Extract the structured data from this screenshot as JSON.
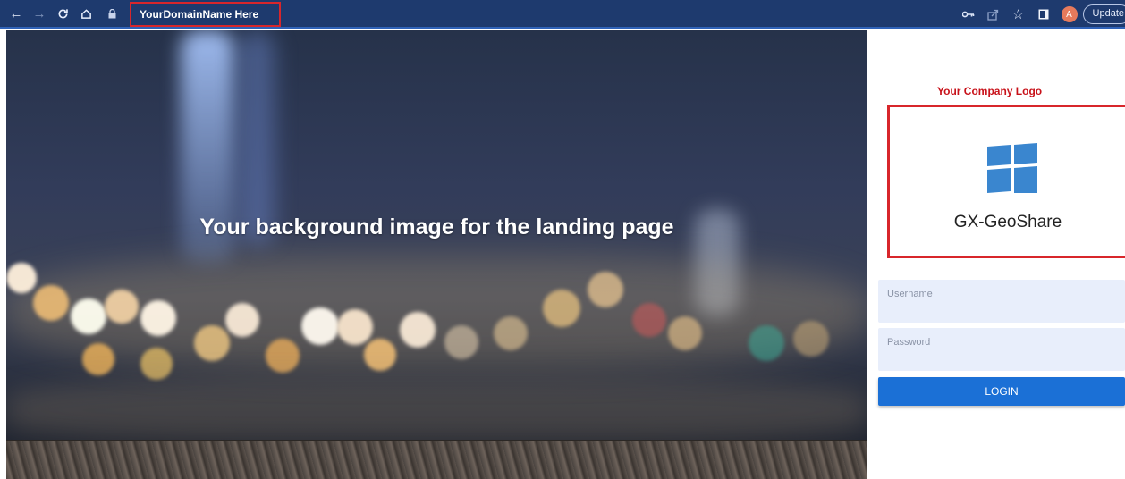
{
  "browser": {
    "url": "YourDomainName Here",
    "update_label": "Update",
    "avatar_initial": "A",
    "icons": [
      "back-arrow-icon",
      "forward-arrow-icon",
      "reload-icon",
      "home-icon",
      "lock-icon",
      "key-icon",
      "share-icon",
      "star-icon",
      "sidebar-icon"
    ]
  },
  "landing": {
    "background_caption": "Your background image for the landing page"
  },
  "login_panel": {
    "logo_label": "Your Company Logo",
    "product_name": "GX-GeoShare",
    "username_placeholder": "Username",
    "password_placeholder": "Password",
    "login_label": "LOGIN"
  },
  "colors": {
    "browser_bar": "#1e3a6e",
    "highlight_border": "#d8262b",
    "logo_blue": "#3a86cf",
    "login_button": "#1b70d6",
    "field_background": "#e8eefb"
  }
}
